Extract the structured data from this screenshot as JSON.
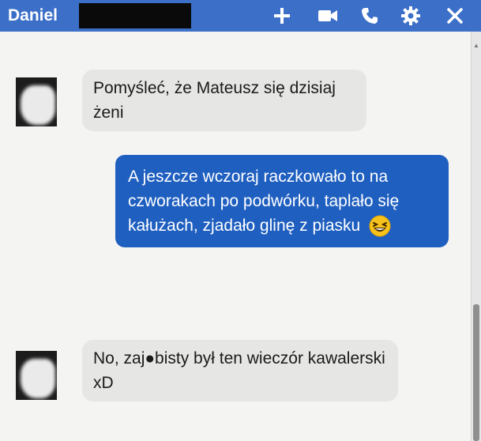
{
  "header": {
    "contact_name": "Daniel",
    "icons": [
      "add-icon",
      "video-call-icon",
      "phone-icon",
      "gear-icon",
      "close-icon"
    ],
    "color": "#3b6fc8"
  },
  "messages": [
    {
      "direction": "incoming",
      "text": "Pomyśleć, że Mateusz się dzisiaj żeni"
    },
    {
      "direction": "outgoing",
      "text": "A jeszcze wczoraj raczkowało to na czworakach po podwórku, taplało się kałużach, zjadało glinę z piasku",
      "emoji": "laughing-emoji"
    },
    {
      "direction": "incoming",
      "text": "No, zaj●bisty był ten wieczór kawalerski xD"
    }
  ],
  "colors": {
    "outgoing_bubble": "#1f5fc0",
    "incoming_bubble": "#e6e6e4"
  }
}
